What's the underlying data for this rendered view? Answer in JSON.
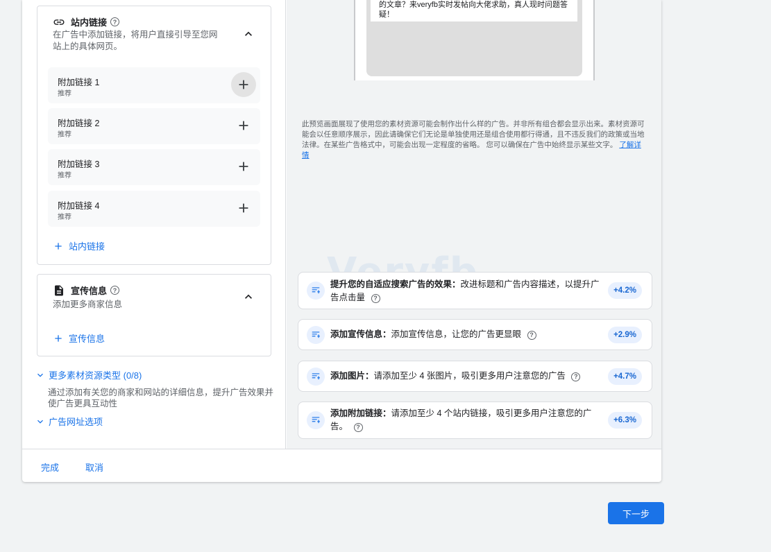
{
  "sitelinks": {
    "title": "站内链接",
    "description": "在广告中添加链接，将用户直接引导至您网站上的具体网页。",
    "items": [
      {
        "label": "附加链接 1",
        "sub": "推荐"
      },
      {
        "label": "附加链接 2",
        "sub": "推荐"
      },
      {
        "label": "附加链接 3",
        "sub": "推荐"
      },
      {
        "label": "附加链接 4",
        "sub": "推荐"
      }
    ],
    "add_label": "站内链接"
  },
  "callouts": {
    "title": "宣传信息",
    "description": "添加更多商家信息",
    "add_label": "宣传信息"
  },
  "more_assets": {
    "label": "更多素材资源类型 (0/8)",
    "description": "通过添加有关您的商家和网站的详细信息，提升广告效果并使广告更具互动性"
  },
  "url_options": {
    "label": "广告网址选项"
  },
  "preview": {
    "ad_text": "的文章？来veryfb实时发帖向大佬求助，真人现时问题答疑！",
    "disclaimer": "此预览画面展现了使用您的素材资源可能会制作出什么样的广告。并非所有组合都会显示出来。素材资源可能会以任意顺序展示，因此请确保它们无论是单独使用还是组合使用都行得通，且不违反我们的政策或当地法律。在某些广告格式中，可能会出现一定程度的省略。 您可以确保在广告中始终显示某些文字。",
    "learn_more": "了解详情"
  },
  "watermark": "Veryfb",
  "recommendations": [
    {
      "bold": "提升您的自适应搜索广告的效果：",
      "text": "改进标题和广告内容描述，以提升广告点击量",
      "badge": "+4.2%"
    },
    {
      "bold": "添加宣传信息：",
      "text": "添加宣传信息，让您的广告更显眼",
      "badge": "+2.9%"
    },
    {
      "bold": "添加图片：",
      "text": "请添加至少 4 张图片，吸引更多用户注意您的广告",
      "badge": "+4.7%"
    },
    {
      "bold": "添加附加链接：",
      "text": "请添加至少 4 个站内链接，吸引更多用户注意您的广告。",
      "badge": "+6.3%"
    }
  ],
  "footer": {
    "done": "完成",
    "cancel": "取消"
  },
  "next_button": "下一步",
  "colors": {
    "accent": "#1a73e8",
    "badge_bg": "#e8f0fe",
    "panel_bg": "#f1f3f4"
  },
  "icons": [
    "link-icon",
    "help-icon",
    "chevron-up-icon",
    "plus-icon",
    "document-icon",
    "chevron-down-icon",
    "recommendation-icon"
  ]
}
